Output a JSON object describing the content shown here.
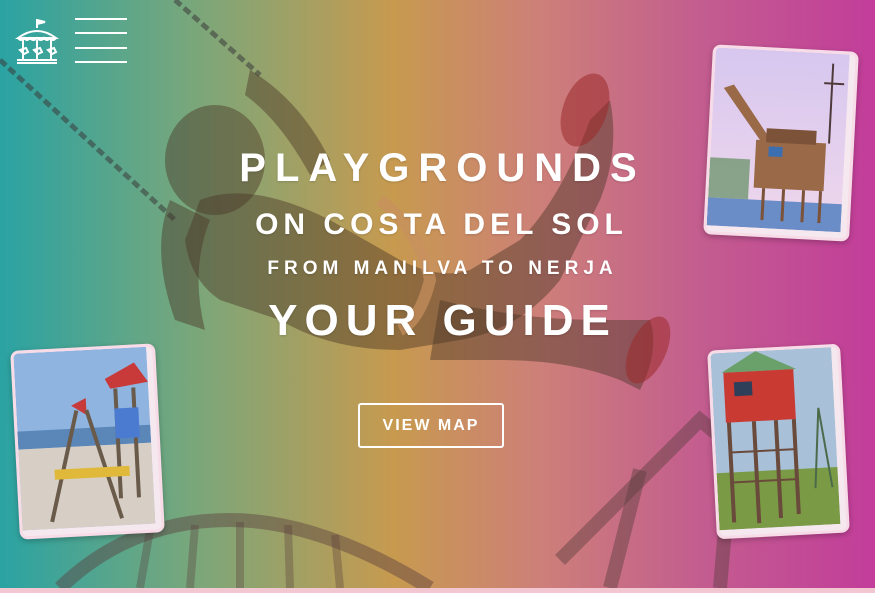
{
  "header": {
    "logo_icon": "carousel-icon",
    "menu_icon": "hamburger-menu-icon"
  },
  "hero": {
    "title_line1": "PLAYGROUNDS",
    "title_line2": "ON COSTA DEL SOL",
    "title_line3": "FROM MANILVA TO NERJA",
    "title_line4": "YOUR GUIDE",
    "cta_label": "VIEW MAP"
  },
  "photos": {
    "top_right": "playground-ship-photo",
    "bottom_left": "beach-playground-photo",
    "bottom_right": "playground-tower-photo"
  },
  "colors": {
    "gradient_left": "#2aa3a3",
    "gradient_mid": "#c79a4f",
    "gradient_right": "#c23d9a",
    "text": "#ffffff",
    "card_border": "#f7dbe7",
    "bottom_strip": "#f2c7d2"
  }
}
